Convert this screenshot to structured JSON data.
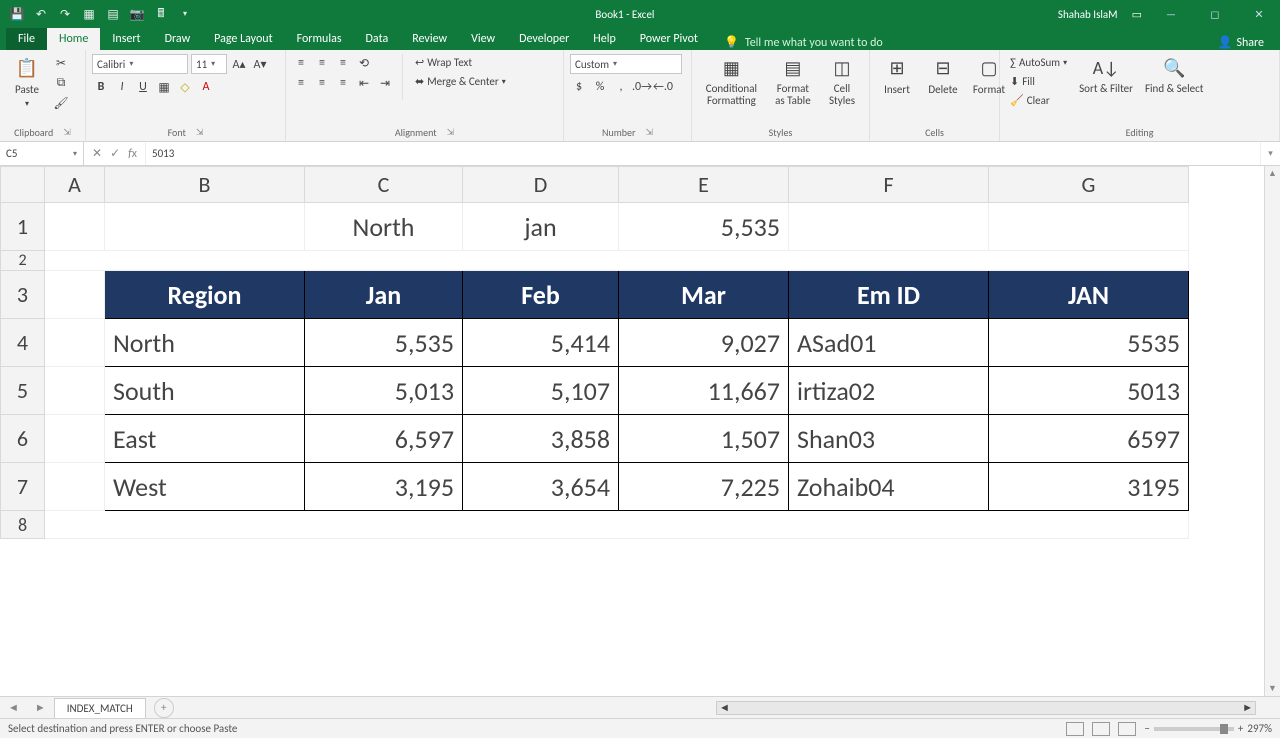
{
  "titlebar": {
    "title": "Book1 - Excel",
    "user": "Shahab IslaM"
  },
  "tabs": {
    "file": "File",
    "items": [
      "Home",
      "Insert",
      "Draw",
      "Page Layout",
      "Formulas",
      "Data",
      "Review",
      "View",
      "Developer",
      "Help",
      "Power Pivot"
    ],
    "active": "Home",
    "tellme": "Tell me what you want to do",
    "share": "Share"
  },
  "ribbon": {
    "clipboard": {
      "label": "Clipboard",
      "paste": "Paste"
    },
    "font": {
      "label": "Font",
      "name": "Calibri",
      "size": "11"
    },
    "alignment": {
      "label": "Alignment",
      "wrap": "Wrap Text",
      "merge": "Merge & Center"
    },
    "number": {
      "label": "Number",
      "format": "Custom"
    },
    "styles": {
      "label": "Styles",
      "cond": "Conditional Formatting",
      "table": "Format as Table",
      "cell": "Cell Styles"
    },
    "cells": {
      "label": "Cells",
      "insert": "Insert",
      "delete": "Delete",
      "format": "Format"
    },
    "editing": {
      "label": "Editing",
      "autosum": "AutoSum",
      "fill": "Fill",
      "clear": "Clear",
      "sort": "Sort & Filter",
      "find": "Find & Select"
    }
  },
  "namebox": "C5",
  "formula": "5013",
  "columns": [
    "A",
    "B",
    "C",
    "D",
    "E",
    "F",
    "G"
  ],
  "lookup": {
    "c": "North",
    "d": "jan",
    "e": "5,535"
  },
  "headers": [
    "Region",
    "Jan",
    "Feb",
    "Mar",
    "Em ID",
    "JAN"
  ],
  "rows": [
    {
      "region": "North",
      "jan": "5,535",
      "feb": "5,414",
      "mar": "9,027",
      "emid": "ASad01",
      "jan2": "5535"
    },
    {
      "region": "South",
      "jan": "5,013",
      "feb": "5,107",
      "mar": "11,667",
      "emid": "irtiza02",
      "jan2": "5013"
    },
    {
      "region": "East",
      "jan": "6,597",
      "feb": "3,858",
      "mar": "1,507",
      "emid": "Shan03",
      "jan2": "6597"
    },
    {
      "region": "West",
      "jan": "3,195",
      "feb": "3,654",
      "mar": "7,225",
      "emid": "Zohaib04",
      "jan2": "3195"
    }
  ],
  "sheettab": "INDEX_MATCH",
  "status": {
    "msg": "Select destination and press ENTER or choose Paste",
    "zoom": "297%"
  }
}
